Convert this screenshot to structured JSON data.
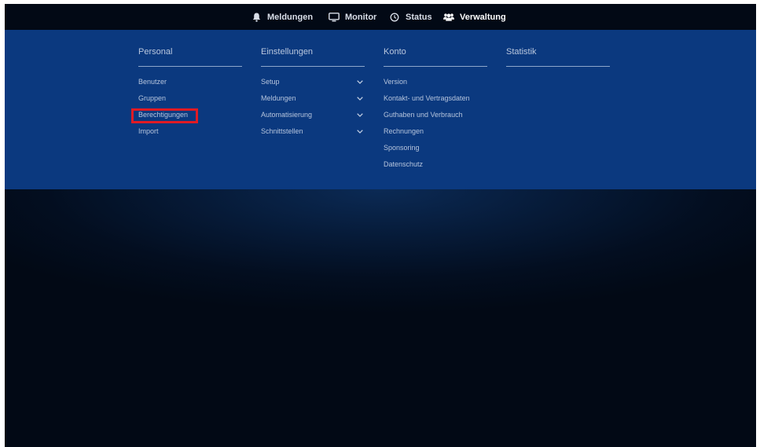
{
  "nav": {
    "items": [
      {
        "label": "Meldungen",
        "icon": "bell-icon"
      },
      {
        "label": "Monitor",
        "icon": "monitor-icon"
      },
      {
        "label": "Status",
        "icon": "clock-icon"
      },
      {
        "label": "Verwaltung",
        "icon": "users-icon",
        "active": true
      }
    ]
  },
  "menu": {
    "columns": [
      {
        "title": "Personal",
        "items": [
          {
            "label": "Benutzer"
          },
          {
            "label": "Gruppen"
          },
          {
            "label": "Berechtigungen",
            "highlighted": true
          },
          {
            "label": "Import"
          }
        ]
      },
      {
        "title": "Einstellungen",
        "items": [
          {
            "label": "Setup",
            "expandable": true
          },
          {
            "label": "Meldungen",
            "expandable": true
          },
          {
            "label": "Automatisierung",
            "expandable": true
          },
          {
            "label": "Schnittstellen",
            "expandable": true
          }
        ]
      },
      {
        "title": "Konto",
        "items": [
          {
            "label": "Version"
          },
          {
            "label": "Kontakt- und Vertragsdaten"
          },
          {
            "label": "Guthaben und Verbrauch"
          },
          {
            "label": "Rechnungen"
          },
          {
            "label": "Sponsoring"
          },
          {
            "label": "Datenschutz"
          }
        ]
      },
      {
        "title": "Statistik",
        "items": []
      }
    ]
  },
  "colors": {
    "page_bg": "#020915",
    "menu_bg": "#0b397f",
    "highlight": "#e01b24"
  }
}
